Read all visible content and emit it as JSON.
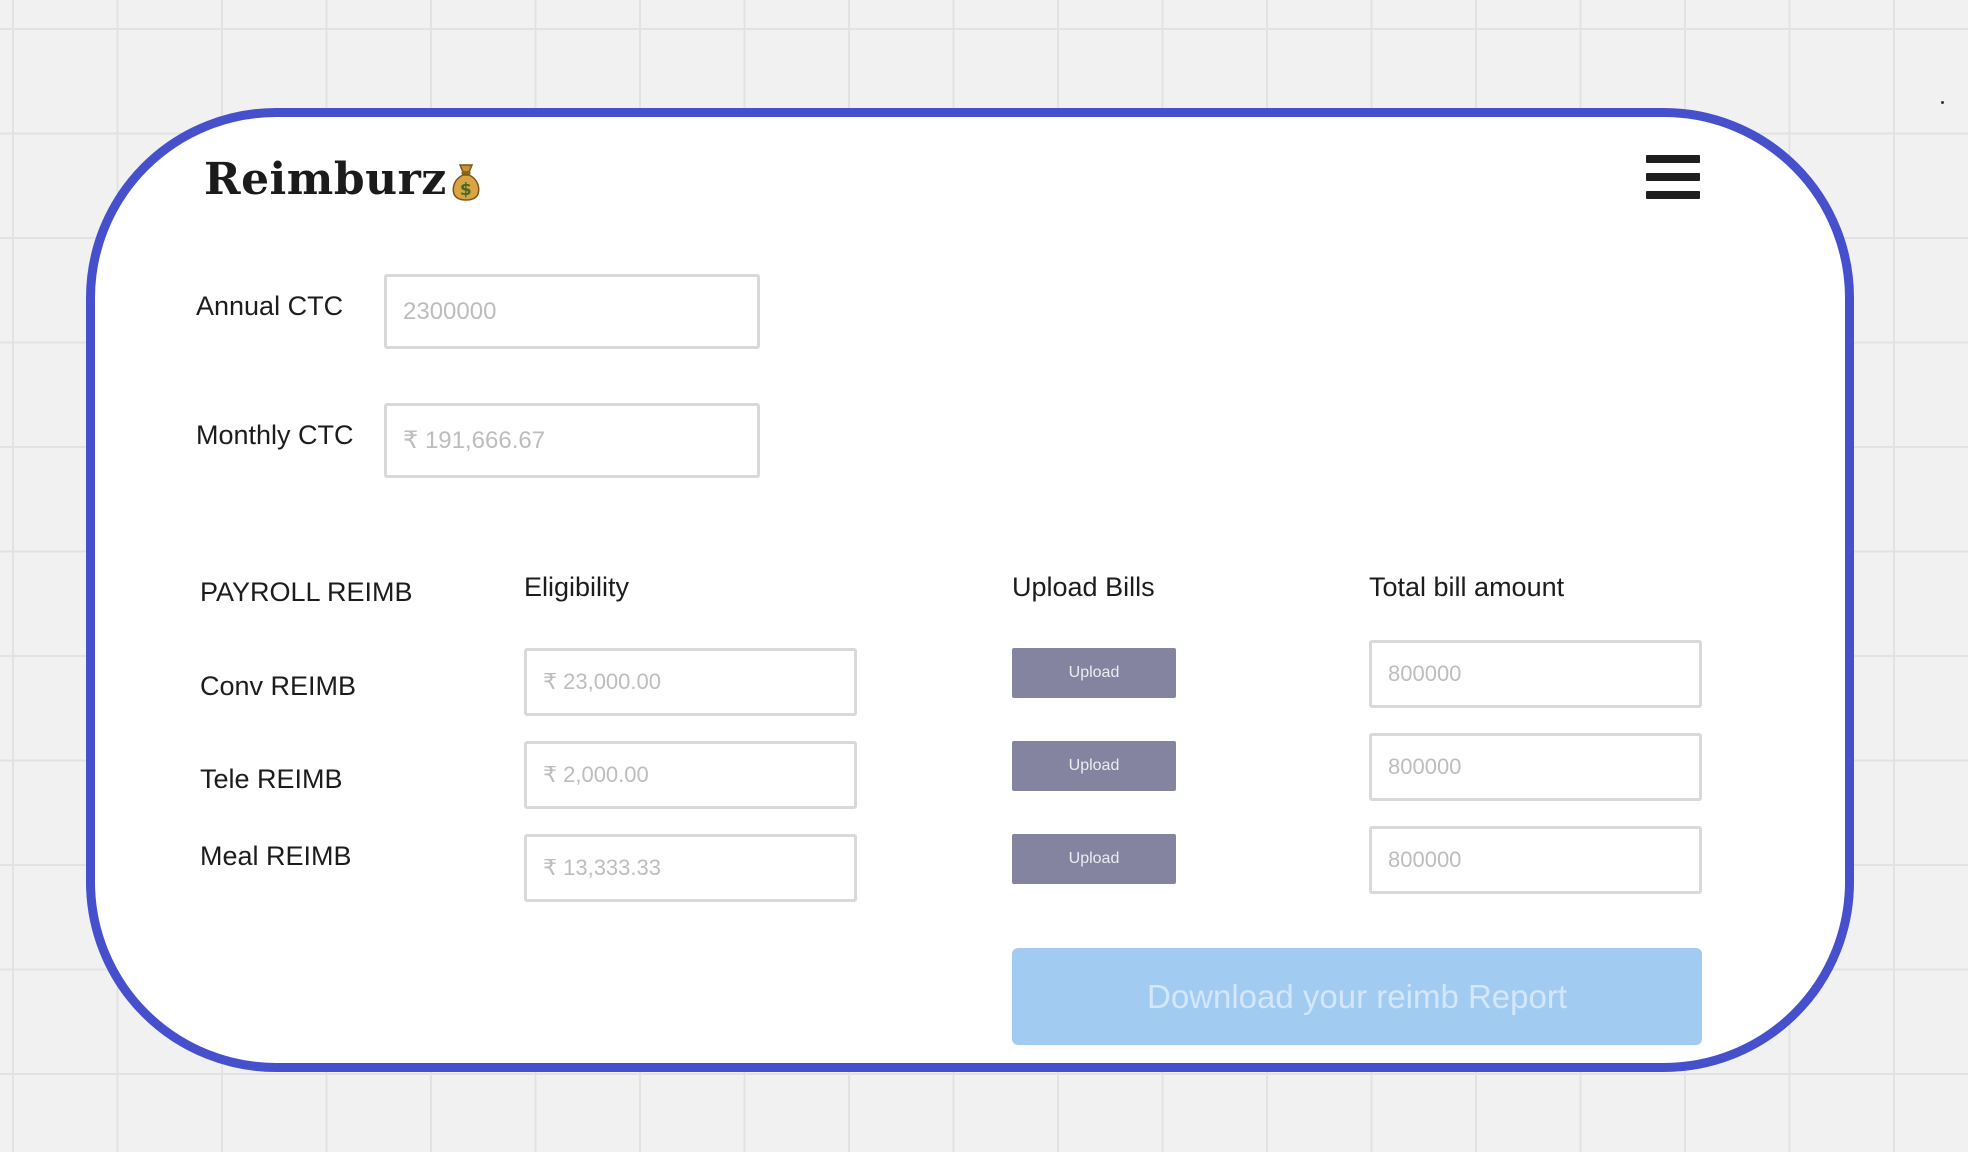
{
  "app": {
    "logo_text": "Reimburz",
    "logo_icon": "money-bag-icon",
    "menu_icon": "hamburger-menu-icon"
  },
  "ctc": {
    "annual_label": "Annual CTC",
    "annual_value": "2300000",
    "monthly_label": "Monthly CTC",
    "monthly_value": "₹ 191,666.67"
  },
  "table": {
    "headers": {
      "category": "PAYROLL REIMB",
      "eligibility": "Eligibility",
      "upload": "Upload Bills",
      "total": "Total bill amount"
    },
    "rows": [
      {
        "label": "Conv REIMB",
        "eligibility": "₹ 23,000.00",
        "upload_label": "Upload",
        "total": "800000"
      },
      {
        "label": "Tele REIMB",
        "eligibility": "₹ 2,000.00",
        "upload_label": "Upload",
        "total": "800000"
      },
      {
        "label": "Meal REIMB",
        "eligibility": "₹ 13,333.33",
        "upload_label": "Upload",
        "total": "800000"
      }
    ]
  },
  "download": {
    "label": "Download your reimb Report"
  },
  "colors": {
    "card_border": "#4650cd",
    "upload_button": "#8584a0",
    "download_button": "#a2cbf2",
    "canvas_background": "#f1f1f1"
  }
}
